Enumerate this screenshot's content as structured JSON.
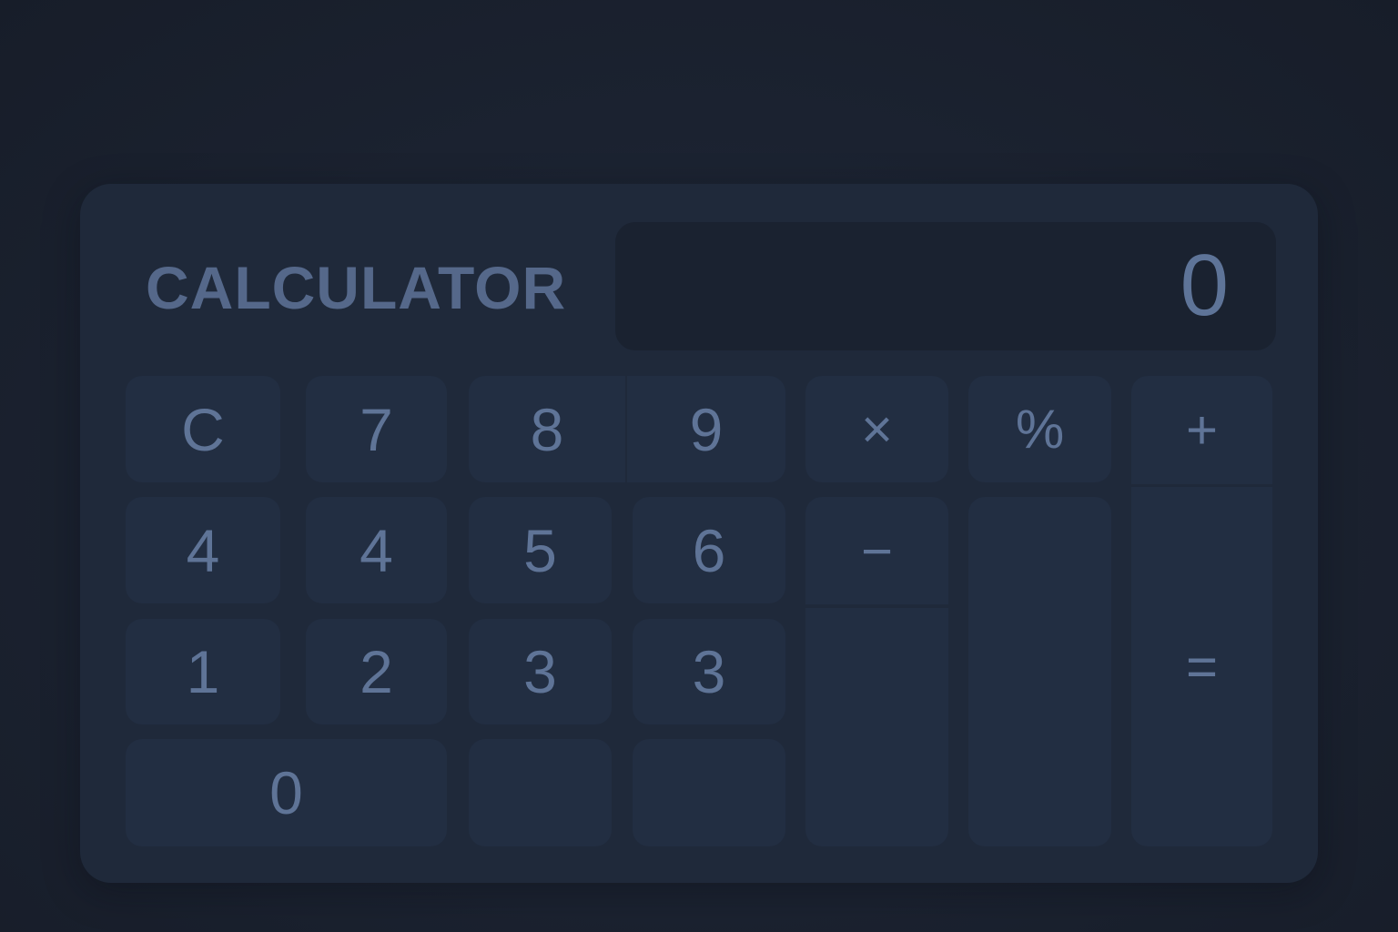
{
  "app": {
    "title": "CALCULATOR"
  },
  "display": {
    "value": "0"
  },
  "keys": {
    "clear": "C",
    "seven": "7",
    "eight": "8",
    "nine": "9",
    "multiply": "×",
    "percent": "%",
    "plus": "+",
    "four_a": "4",
    "four_b": "4",
    "five": "5",
    "six": "6",
    "minus": "−",
    "one": "1",
    "two": "2",
    "three_a": "3",
    "three_b": "3",
    "equals": "=",
    "zero": "0"
  },
  "colors": {
    "background": "#1b2230",
    "panel": "#1f293a",
    "display": "#1a2230",
    "key": "#222e42",
    "text": "#5f7497"
  }
}
